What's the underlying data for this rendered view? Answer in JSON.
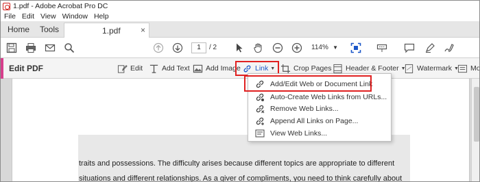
{
  "window": {
    "title": "1.pdf - Adobe Acrobat Pro DC"
  },
  "menubar": {
    "items": [
      "File",
      "Edit",
      "View",
      "Window",
      "Help"
    ]
  },
  "tabs": {
    "home": "Home",
    "tools": "Tools",
    "document": "1.pdf",
    "close": "×"
  },
  "toolbar": {
    "icons": [
      "save-icon",
      "print-icon",
      "email-icon",
      "search-icon",
      "page-up-icon",
      "page-down-icon",
      "select-cursor-icon",
      "hand-icon",
      "zoom-out-icon",
      "zoom-in-icon",
      "fit-page-icon",
      "read-mode-icon",
      "comment-icon",
      "highlight-pen-icon",
      "sign-icon"
    ],
    "page_current": "1",
    "page_total": "/ 2",
    "zoom": "114%"
  },
  "edit_bar": {
    "title": "Edit PDF",
    "tools": {
      "edit": "Edit",
      "add_text": "Add Text",
      "add_image": "Add Image",
      "link": "Link",
      "crop_pages": "Crop Pages",
      "header_footer": "Header & Footer",
      "watermark": "Watermark",
      "more": "Mo"
    }
  },
  "link_menu": {
    "items": [
      "Add/Edit Web or Document Link",
      "Auto-Create Web Links from URLs...",
      "Remove Web Links...",
      "Append All Links on Page...",
      "View Web Links..."
    ]
  },
  "document": {
    "lines": [
      "traits and possessions. The difficulty arises because different topics are appropriate to different",
      "situations and different relationships. As a giver of compliments, you need to think carefully about"
    ]
  },
  "colors": {
    "accent": "#d63f8c",
    "highlight_box": "#e02020",
    "link_blue": "#1a56c8"
  }
}
